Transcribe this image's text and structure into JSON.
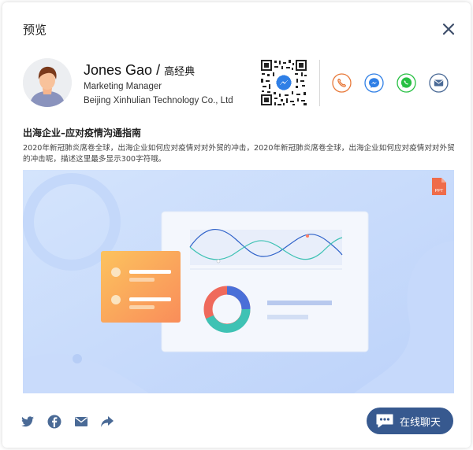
{
  "header": {
    "title": "预览",
    "close_icon": "close-icon"
  },
  "profile": {
    "name": "Jones Gao",
    "separator": "/",
    "name_cn": "高经典",
    "title": "Marketing Manager",
    "company": "Beijing Xinhulian Technology Co., Ltd",
    "avatar_icon": "avatar"
  },
  "qr": {
    "icon": "qr-code-messenger-icon"
  },
  "contacts": [
    {
      "icon": "phone-icon",
      "color": "#e8793a"
    },
    {
      "icon": "messenger-icon",
      "color": "#2f7fe6"
    },
    {
      "icon": "whatsapp-icon",
      "color": "#27c043"
    },
    {
      "icon": "email-icon",
      "color": "#4a6a96"
    }
  ],
  "article": {
    "title": "出海企业–应对疫情沟通指南",
    "description": "2020年新冠肺炎席卷全球，出海企业如何应对疫情对对外贸的冲击，2020年新冠肺炎席卷全球，出海企业如何应对疫情对对外贸的冲击呢，描述这里最多显示300字符哦。"
  },
  "banner": {
    "file_badge": "PPT",
    "colors": {
      "background": "#c8dcfb",
      "card": "#f4f7fd",
      "list_card": "#fbb45c",
      "donut_blue": "#4a6fd8",
      "donut_teal": "#3fc2b4",
      "donut_red": "#ef6a5c"
    }
  },
  "share": [
    {
      "icon": "twitter-icon"
    },
    {
      "icon": "facebook-icon"
    },
    {
      "icon": "email-share-icon"
    },
    {
      "icon": "share-arrow-icon"
    }
  ],
  "chat": {
    "label": "在线聊天",
    "icon": "chat-bubble-icon",
    "color": "#37598f"
  }
}
